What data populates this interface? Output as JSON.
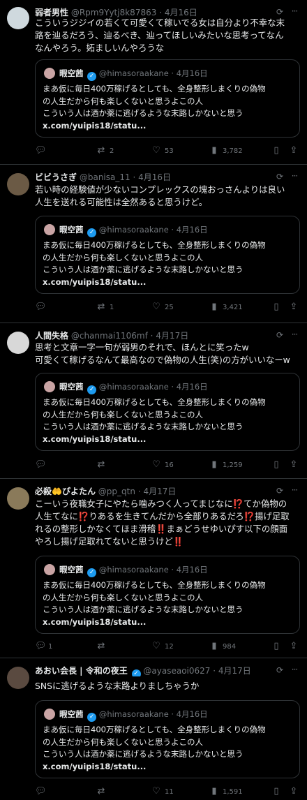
{
  "quote": {
    "name": "暇空茜",
    "handle": "@himasoraakane",
    "date": "4月16日",
    "text": "まあ仮に毎日400万稼げるとしても、全身整形しまくりの偽物\nの人生だから何も楽しくないと思うよこの人\nこういう人は酒か薬に逃げるような末路しかないと思う",
    "text_b": "まあ仮に毎日400万稼げるとしても、全身整形しまくりの偽物\nの人生だから何も楽しくないと思うよこの人\nこういう人は酒か薬に逃げるような末路しかないと思う",
    "link": "x.com/yuipis18/statu..."
  },
  "tweets": [
    {
      "name": "弱者男性",
      "handle": "@Rpm9Yytj8k87863",
      "date": "4月16日",
      "avatar_color": "#cfd9de",
      "text": "こういうジジイの若くて可愛くて稼いでる女は自分より不幸な末\n路を辿るだろう、辿るべき、辿ってほしいみたいな思考ってなん\nなんやろう。妬ましいんやろうな",
      "reply": "",
      "retweets": "2",
      "likes": "53",
      "views": "3,782"
    },
    {
      "name": "ビビうさぎ",
      "handle": "@banisa_11",
      "date": "4月16日",
      "avatar_color": "#6b5a45",
      "text": "若い時の経験値が少ないコンプレックスの塊おっさんよりは良い\n人生を送れる可能性は全然あると思うけど。",
      "reply": "",
      "retweets": "1",
      "likes": "25",
      "views": "3,421"
    },
    {
      "name": "人間失格",
      "handle": "@chanmai1106mf",
      "date": "4月17日",
      "avatar_color": "#d8d8d8",
      "text": "思考と文章一字一句が弱男のそれで、ほんとに笑ったw\n可愛くて稼げるなんて最高なので偽物の人生(笑)の方がいいなーw",
      "reply": "",
      "retweets": "",
      "likes": "16",
      "views": "1,259"
    },
    {
      "name": "必殺🤲ぴよたん",
      "handle": "@pp_qtn",
      "date": "4月17日",
      "avatar_color": "#8a7a5a",
      "text": "こーいう夜職女子にやたら噛みつく人ってまじなに⁉️てか偽物の\n人生てなに⁉️りあるを生きてんだから全部りあるだろ⁉️揚げ足取\nれるの整形しかなくてほま滑稽‼️まぁどうせゆいぴす以下の顔面\nやろし揚げ足取れてないと思うけど‼️",
      "reply": "1",
      "retweets": "",
      "likes": "12",
      "views": "984"
    },
    {
      "name": "あおい会長 | 令和の夜王",
      "handle": "@ayaseaoi0627",
      "date": "4月17日",
      "avatar_color": "#5a4a40",
      "text": "SNSに逃げるような末路よりましちゃうか",
      "reply": "",
      "retweets": "",
      "likes": "11",
      "views": "1,591"
    }
  ],
  "colors": {
    "background": "#000000",
    "text": "#e7e9ea",
    "muted": "#71767b",
    "verified": "#1d9bf0",
    "border": "#2f3336"
  },
  "icons": {
    "reply": "reply-icon",
    "retweet": "retweet-icon",
    "like": "heart-icon",
    "views": "views-icon",
    "bookmark": "bookmark-icon",
    "share": "share-icon",
    "grok": "grok-icon",
    "more": "more-icon",
    "verified": "verified-badge-icon"
  }
}
